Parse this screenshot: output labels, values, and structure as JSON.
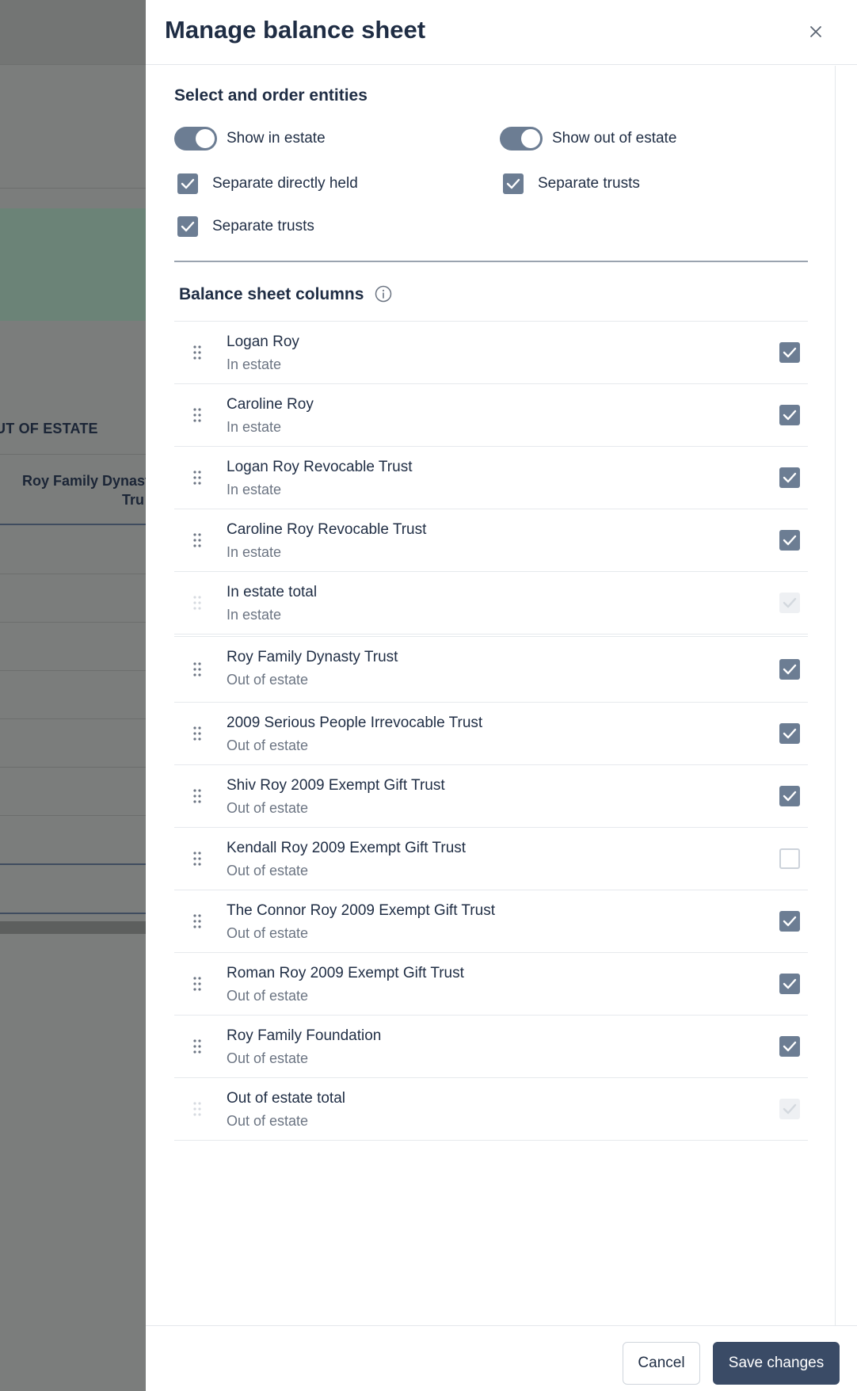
{
  "background": {
    "out_of_estate_label": "UT OF ESTATE",
    "column_label_line1": "Roy Family Dynast",
    "column_label_line2": "Tru"
  },
  "dialog": {
    "title": "Manage balance sheet",
    "close_icon": "close-icon"
  },
  "entities": {
    "title": "Select and order entities",
    "toggles": [
      {
        "label": "Show in estate",
        "on": true
      },
      {
        "label": "Show out of estate",
        "on": true
      }
    ],
    "checks": [
      {
        "label": "Separate directly held",
        "checked": true
      },
      {
        "label": "Separate trusts",
        "checked": true
      },
      {
        "label": "Separate trusts",
        "checked": true
      }
    ]
  },
  "columns": {
    "title": "Balance sheet columns",
    "info_icon": "info-icon",
    "rows": [
      {
        "name": "Logan Roy",
        "group": "In estate",
        "state": "checked"
      },
      {
        "name": "Caroline Roy",
        "group": "In estate",
        "state": "checked"
      },
      {
        "name": "Logan Roy Revocable Trust",
        "group": "In estate",
        "state": "checked"
      },
      {
        "name": "Caroline Roy Revocable Trust",
        "group": "In estate",
        "state": "checked"
      },
      {
        "name": "In estate total",
        "group": "In estate",
        "state": "disabled"
      },
      {
        "name": "Roy Family Dynasty Trust",
        "group": "Out of estate",
        "state": "checked"
      },
      {
        "name": "2009 Serious People Irrevocable Trust",
        "group": "Out of estate",
        "state": "checked"
      },
      {
        "name": "Shiv Roy 2009 Exempt Gift Trust",
        "group": "Out of estate",
        "state": "checked"
      },
      {
        "name": "Kendall Roy 2009 Exempt Gift Trust",
        "group": "Out of estate",
        "state": "unchecked"
      },
      {
        "name": "The Connor Roy 2009 Exempt Gift Trust",
        "group": "Out of estate",
        "state": "checked"
      },
      {
        "name": "Roman Roy 2009 Exempt Gift Trust",
        "group": "Out of estate",
        "state": "checked"
      },
      {
        "name": "Roy Family Foundation",
        "group": "Out of estate",
        "state": "checked"
      },
      {
        "name": "Out of estate total",
        "group": "Out of estate",
        "state": "disabled"
      }
    ]
  },
  "footer": {
    "cancel_label": "Cancel",
    "save_label": "Save changes"
  },
  "colors": {
    "accent": "#6c7d93",
    "primary_button": "#3a4b66",
    "text": "#1f2d44",
    "muted": "#6b7482"
  }
}
